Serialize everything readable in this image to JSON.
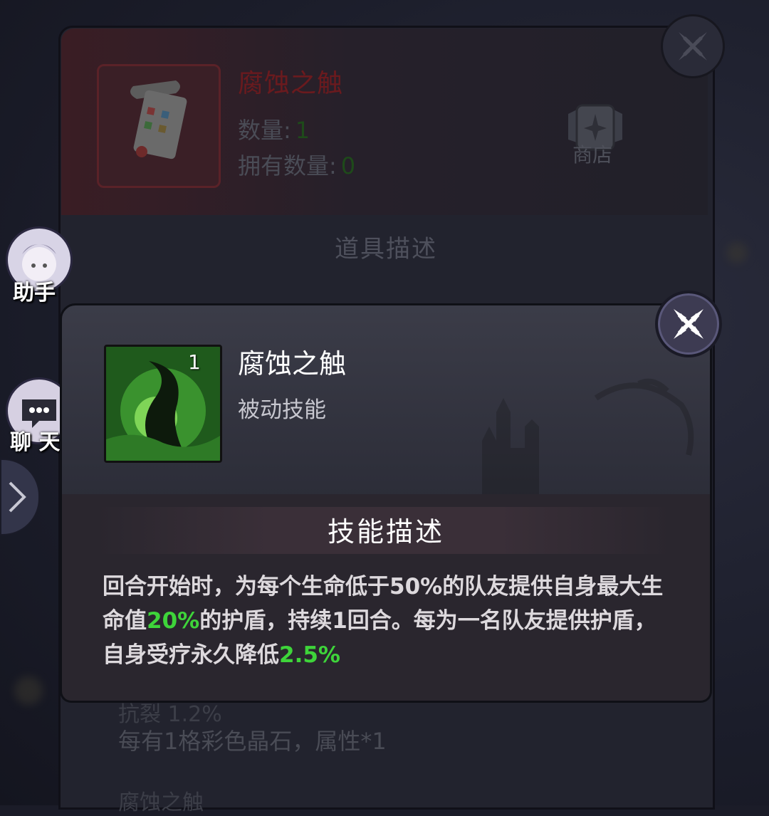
{
  "item_panel": {
    "name": "腐蚀之触",
    "quantity_label": "数量:",
    "quantity_value": "1",
    "owned_label": "拥有数量:",
    "owned_value": "0",
    "shop_label": "商店",
    "description_header": "道具描述",
    "faded_lines": [
      "抗裂  1.2%",
      "每有1格彩色晶石，属性*1",
      "腐蚀之触"
    ]
  },
  "sidebar": {
    "assistant_label": "助手",
    "chat_label": "聊 天"
  },
  "skill_popup": {
    "level": "1",
    "name": "腐蚀之触",
    "type": "被动技能",
    "description_header": "技能描述",
    "description_parts": [
      {
        "text": "回合开始时，为每个生命低于50%的队友提供自身最大生命值",
        "highlight": false
      },
      {
        "text": "20%",
        "highlight": true
      },
      {
        "text": "的护盾，持续1回合。每为一名队友提供护盾，自身受疗永久降低",
        "highlight": false
      },
      {
        "text": "2.5%",
        "highlight": true
      }
    ]
  },
  "colors": {
    "highlight": "#3ed43a",
    "item_name_dimmed": "#6a1a1e"
  },
  "icons": [
    "close-icon",
    "shop-icon",
    "scroll-icon",
    "assistant-avatar-icon",
    "chat-bubble-icon",
    "chevron-right-icon",
    "corrosion-skill-icon"
  ]
}
